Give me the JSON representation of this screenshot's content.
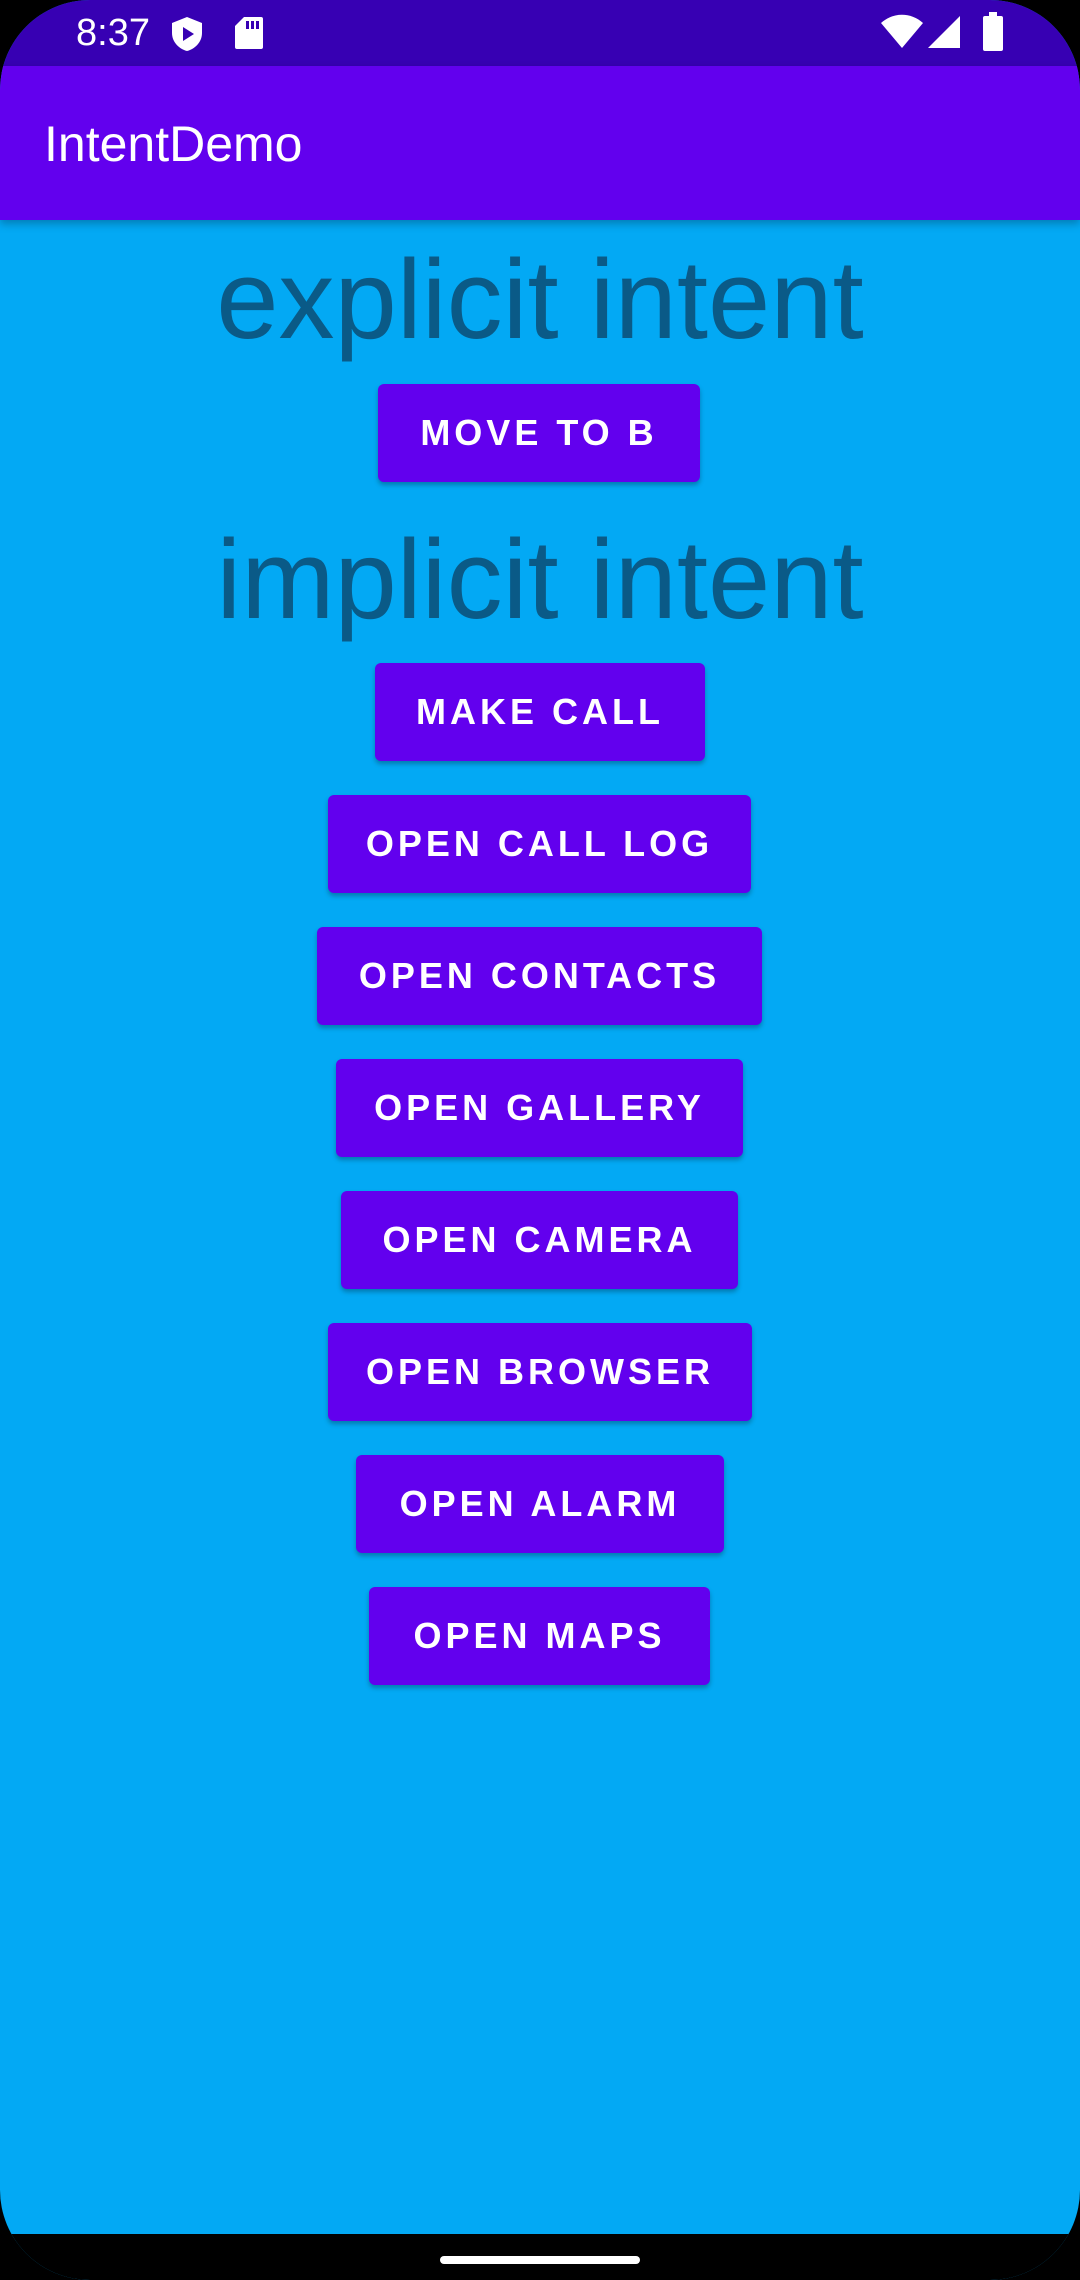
{
  "status_bar": {
    "time": "8:37",
    "left_icons": [
      "shield-play-icon",
      "sd-card-icon"
    ],
    "right_icons": [
      "wifi-icon",
      "cellular-signal-icon",
      "battery-icon"
    ]
  },
  "app_bar": {
    "title": "IntentDemo"
  },
  "sections": {
    "explicit_heading": "explicit intent",
    "implicit_heading": "implicit intent"
  },
  "buttons": {
    "move_to_b": "MOVE TO B",
    "make_call": "MAKE CALL",
    "open_call_log": "OPEN CALL LOG",
    "open_contacts": "OPEN CONTACTS",
    "open_gallery": "OPEN GALLERY",
    "open_camera": "OPEN CAMERA",
    "open_browser": "OPEN BROWSER",
    "open_alarm": "OPEN ALARM",
    "open_maps": "OPEN MAPS"
  },
  "colors": {
    "status_bar": "#3700B3",
    "app_bar": "#6200EE",
    "background": "#03A9F4",
    "heading_text": "#0A5A87",
    "button": "#6200EE"
  }
}
